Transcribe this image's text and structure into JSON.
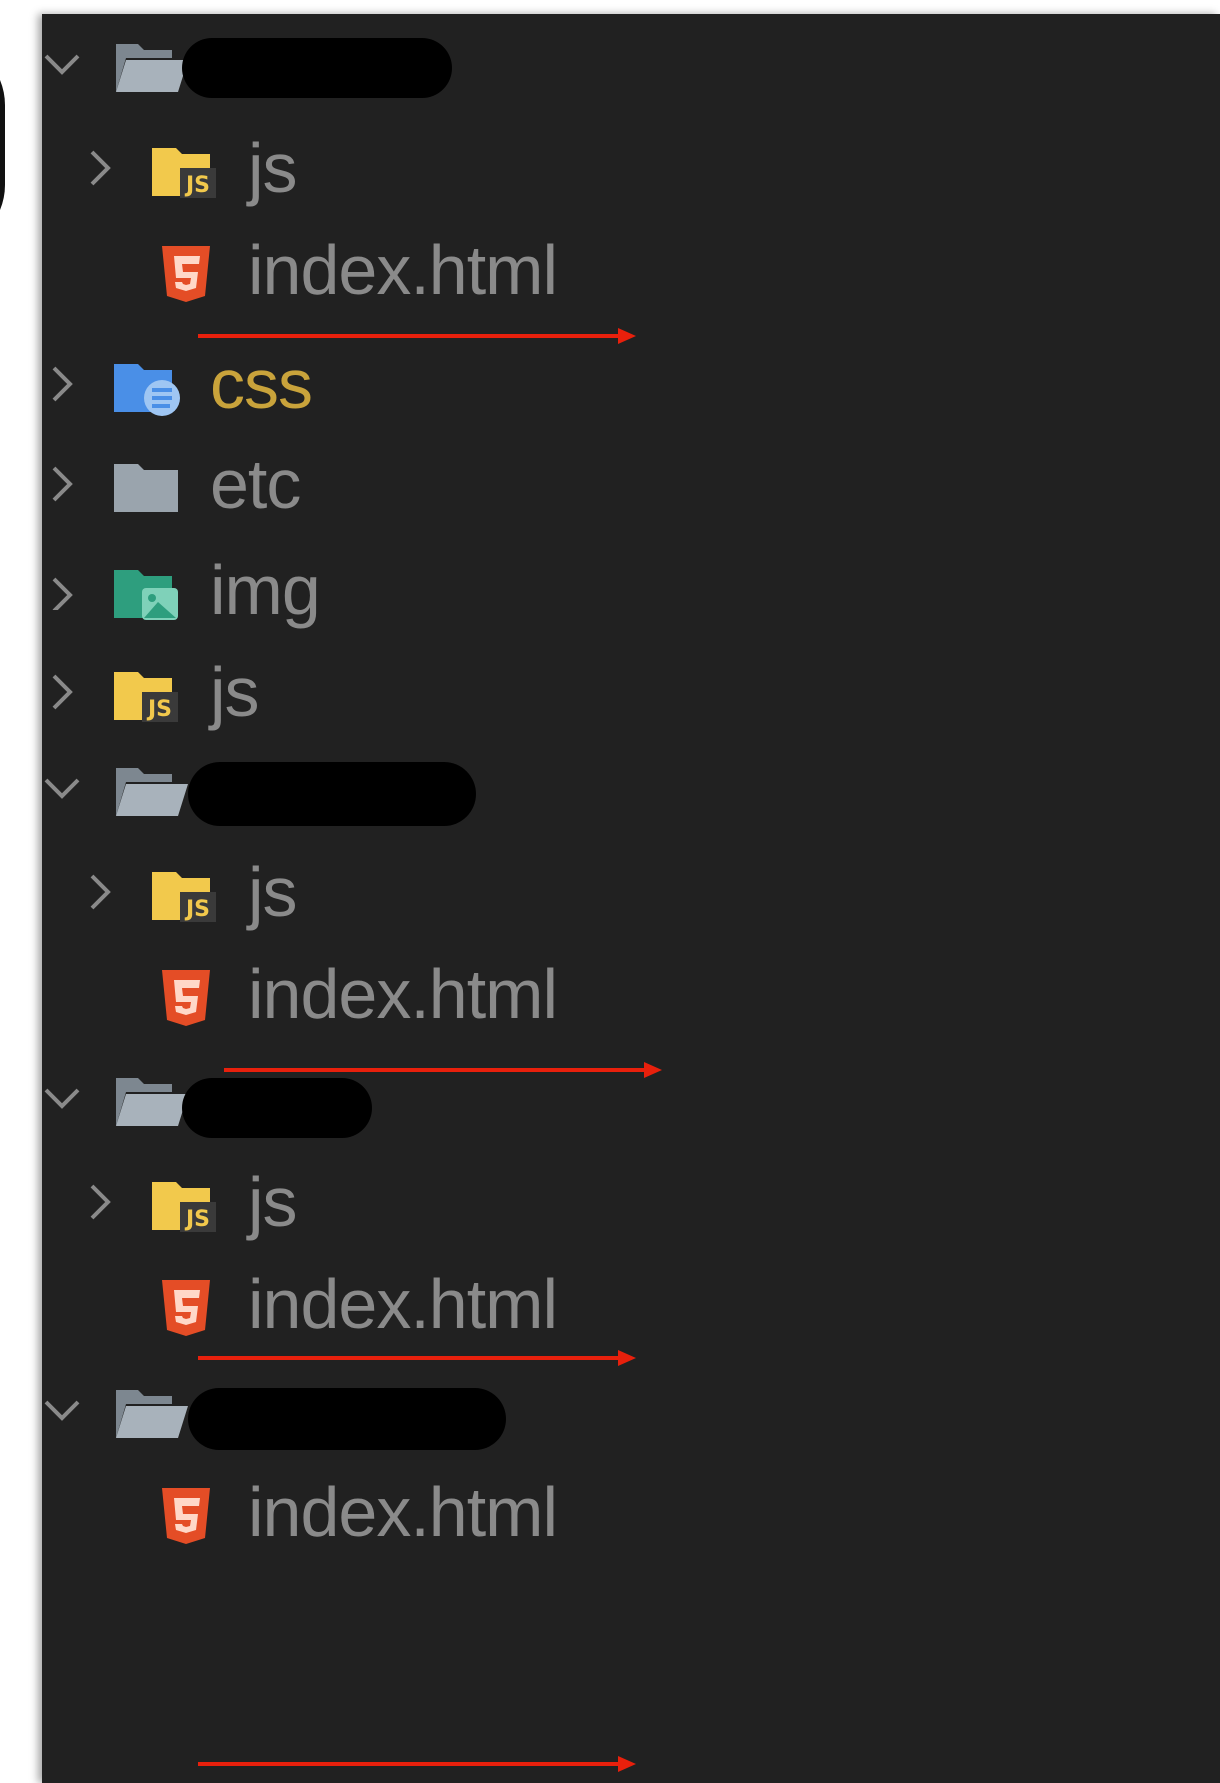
{
  "tree": {
    "items": [
      {
        "kind": "folder-open",
        "name": "",
        "depth": 0,
        "expanded": true,
        "redacted": true
      },
      {
        "kind": "folder-js",
        "name": "js",
        "depth": 1,
        "expanded": false
      },
      {
        "kind": "file-html",
        "name": "index.html",
        "depth": 1
      },
      {
        "kind": "folder-css",
        "name": "css",
        "depth": 0,
        "expanded": false
      },
      {
        "kind": "folder",
        "name": "etc",
        "depth": 0,
        "expanded": false
      },
      {
        "kind": "folder-img",
        "name": "img",
        "depth": 0,
        "expanded": false
      },
      {
        "kind": "folder-js",
        "name": "js",
        "depth": 0,
        "expanded": false
      },
      {
        "kind": "folder-open",
        "name": "",
        "depth": 0,
        "expanded": true,
        "redacted": true
      },
      {
        "kind": "folder-js",
        "name": "js",
        "depth": 1,
        "expanded": false
      },
      {
        "kind": "file-html",
        "name": "index.html",
        "depth": 1
      },
      {
        "kind": "folder-open",
        "name": "",
        "depth": 0,
        "expanded": true,
        "redacted": true
      },
      {
        "kind": "folder-js",
        "name": "js",
        "depth": 1,
        "expanded": false
      },
      {
        "kind": "file-html",
        "name": "index.html",
        "depth": 1
      },
      {
        "kind": "folder-open",
        "name": "",
        "depth": 0,
        "expanded": true,
        "redacted": true
      },
      {
        "kind": "file-html",
        "name": "index.html",
        "depth": 1
      }
    ]
  },
  "annotations": {
    "arrow_color": "#e8200c",
    "arrow_count": 4
  },
  "colors": {
    "panel_bg": "#212121",
    "label": "#8a8a8a",
    "css_label": "#c9a33b",
    "html_icon": "#e44d26",
    "js_folder": "#f2c94c",
    "css_folder": "#4a8fe7",
    "img_folder": "#2e9e7e",
    "plain_folder": "#9aa4ad"
  }
}
